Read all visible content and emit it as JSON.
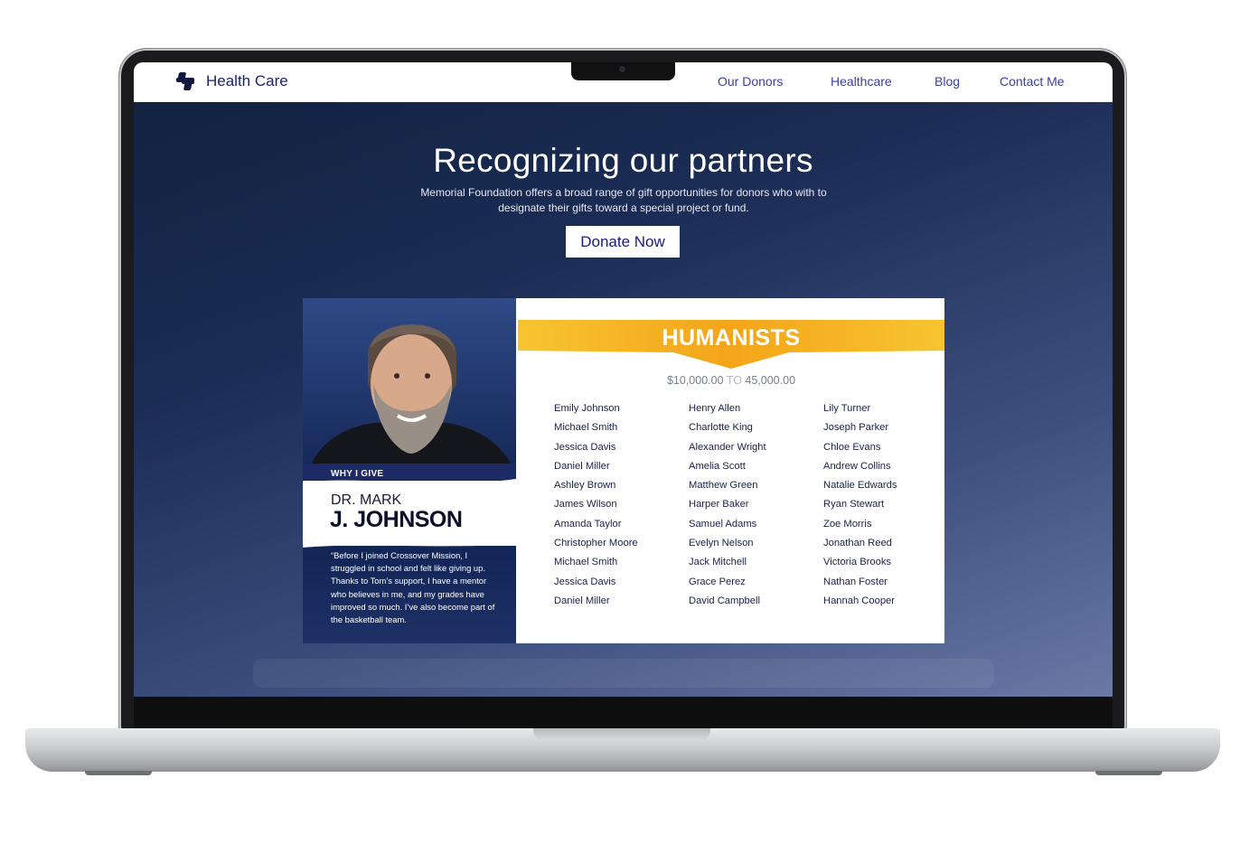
{
  "nav": {
    "brand": "Health Care",
    "links": [
      "Our Donors",
      "Healthcare",
      "Blog",
      "Contact Me"
    ]
  },
  "hero": {
    "title": "Recognizing our partners",
    "subtitle": "Memorial Foundation offers a broad range of gift opportunities for donors who with to designate their gifts toward a special project or fund.",
    "cta": "Donate Now"
  },
  "profile": {
    "section_label": "WHY I GIVE",
    "name_line1": "DR. MARK",
    "name_line2": "J. JOHNSON",
    "quote": "“Before I joined Crossover Mission, I struggled in school and felt like giving up. Thanks to Tom’s support, I have a mentor who believes in me, and my grades have improved so much. I’ve also become part of the basketball team."
  },
  "donors": {
    "tier": "HUMANISTS",
    "range_low": "$10,000.00",
    "range_sep": "TO",
    "range_high": "45,000.00",
    "columns": [
      [
        "Emily Johnson",
        "Michael Smith",
        "Jessica Davis",
        "Daniel Miller",
        "Ashley Brown",
        "James Wilson",
        "Amanda Taylor",
        "Christopher Moore",
        "Michael Smith",
        "Jessica Davis",
        "Daniel Miller"
      ],
      [
        "Henry Allen",
        "Charlotte King",
        "Alexander Wright",
        "Amelia Scott",
        "Matthew Green",
        "Harper Baker",
        "Samuel Adams",
        "Evelyn Nelson",
        "Jack Mitchell",
        "Grace Perez",
        "David Campbell"
      ],
      [
        "Lily Turner",
        "Joseph Parker",
        "Chloe Evans",
        "Andrew Collins",
        "Natalie Edwards",
        "Ryan Stewart",
        "Zoe Morris",
        "Jonathan Reed",
        "Victoria Brooks",
        "Nathan Foster",
        "Hannah Cooper"
      ]
    ]
  },
  "colors": {
    "nav_link": "#3a3fa0",
    "brand": "#1b2170",
    "ribbon_gold": "#f6b81c",
    "hero_bg_dark": "#10203f",
    "hero_bg_light": "#6a79a6"
  }
}
